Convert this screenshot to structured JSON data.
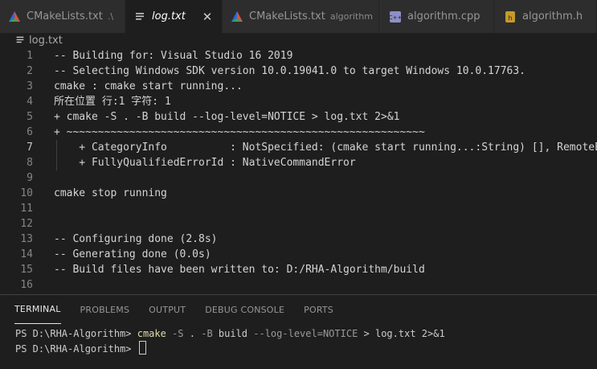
{
  "tabs": [
    {
      "name": "CMakeLists.txt",
      "desc": ".\\",
      "icon": "cmake-icon",
      "active": false
    },
    {
      "name": "log.txt",
      "desc": "",
      "icon": "text-file-icon",
      "active": true,
      "close": "✕"
    },
    {
      "name": "CMakeLists.txt",
      "desc": "algorithm",
      "icon": "cmake-icon",
      "active": false
    },
    {
      "name": "algorithm.cpp",
      "desc": "",
      "icon": "cpp-file-icon",
      "active": false
    },
    {
      "name": "algorithm.h",
      "desc": "",
      "icon": "h-file-icon",
      "active": false
    }
  ],
  "breadcrumb": {
    "file": "log.txt"
  },
  "editor": {
    "active_line": "7",
    "lines": [
      {
        "n": "1",
        "text": "-- Building for: Visual Studio 16 2019"
      },
      {
        "n": "2",
        "text": "-- Selecting Windows SDK version 10.0.19041.0 to target Windows 10.0.17763."
      },
      {
        "n": "3",
        "text": "cmake : cmake start running..."
      },
      {
        "n": "4",
        "text": "所在位置 行:1 字符: 1"
      },
      {
        "n": "5",
        "text": "+ cmake -S . -B build --log-level=NOTICE > log.txt 2>&1"
      },
      {
        "n": "6",
        "text": "+ ~~~~~~~~~~~~~~~~~~~~~~~~~~~~~~~~~~~~~~~~~~~~~~~~~~~~~~~~~"
      },
      {
        "n": "7",
        "text": "    + CategoryInfo          : NotSpecified: (cmake start running...:String) [], RemoteEx"
      },
      {
        "n": "8",
        "text": "    + FullyQualifiedErrorId : NativeCommandError"
      },
      {
        "n": "9",
        "text": ""
      },
      {
        "n": "10",
        "text": "cmake stop running"
      },
      {
        "n": "11",
        "text": ""
      },
      {
        "n": "12",
        "text": ""
      },
      {
        "n": "13",
        "text": "-- Configuring done (2.8s)"
      },
      {
        "n": "14",
        "text": "-- Generating done (0.0s)"
      },
      {
        "n": "15",
        "text": "-- Build files have been written to: D:/RHA-Algorithm/build"
      },
      {
        "n": "16",
        "text": ""
      }
    ]
  },
  "panel": {
    "tabs": [
      "TERMINAL",
      "PROBLEMS",
      "OUTPUT",
      "DEBUG CONSOLE",
      "PORTS"
    ],
    "active_tab": "TERMINAL"
  },
  "terminal": {
    "line1": {
      "prompt": "PS D:\\RHA-Algorithm> ",
      "cmd": "cmake",
      "a1": " -S",
      "a2": " . ",
      "a3": "-B",
      "a4": " build ",
      "a5": "--log-level=NOTICE",
      "a6": " > log.txt 2>&1"
    },
    "line2": {
      "prompt": "PS D:\\RHA-Algorithm> "
    }
  },
  "colors": {
    "cmake_red": "#e44d3a",
    "cmake_green": "#3fa34d",
    "cmake_blue": "#2a6ad8",
    "cpp_icon": "#8f8fc8",
    "h_icon": "#c59a2b",
    "text_icon": "#c5c5c5"
  }
}
